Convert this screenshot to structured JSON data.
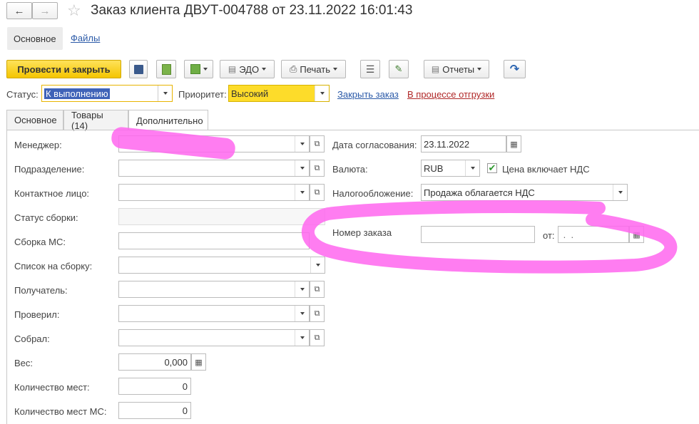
{
  "window": {
    "title": "Заказ клиента ДВУТ-004788 от 23.11.2022 16:01:43"
  },
  "top_tabs": {
    "main": "Основное",
    "files": "Файлы"
  },
  "toolbar": {
    "post_close": "Провести и закрыть",
    "edo": "ЭДО",
    "print": "Печать",
    "reports": "Отчеты"
  },
  "status_row": {
    "status_label": "Статус:",
    "status_value": "К выполнению",
    "priority_label": "Приоритет:",
    "priority_value": "Высокий",
    "close_order": "Закрыть заказ",
    "shipping": "В процессе отгрузки"
  },
  "colors": {
    "accent": "#f4c500",
    "link": "#2b5aa8",
    "link_red": "#b02828",
    "highlight": "#ff66ee"
  },
  "form_tabs": {
    "main": "Основное",
    "goods": "Товары (14)",
    "additional": "Дополнительно"
  },
  "left_fields": {
    "manager": "Менеджер:",
    "department": "Подразделение:",
    "contact": "Контактное лицо:",
    "assembly_status": "Статус сборки:",
    "assembly_ms": "Сборка МС:",
    "assembly_list": "Список на сборку:",
    "receiver": "Получатель:",
    "checked": "Проверил:",
    "assembled": "Собрал:",
    "weight": "Вес:",
    "weight_value": "0,000",
    "places": "Количество мест:",
    "places_value": "0",
    "places_ms": "Количество мест МС:",
    "places_ms_value": "0"
  },
  "right_fields": {
    "agree_date_label": "Дата согласования:",
    "agree_date": "23.11.2022",
    "currency_label": "Валюта:",
    "currency": "RUB",
    "vat_included": "Цена включает НДС",
    "taxation_label": "Налогообложение:",
    "taxation": "Продажа облагается НДС",
    "order_no_label": "Номер заказа",
    "from_label": "от:",
    "from_value": " .  ."
  }
}
